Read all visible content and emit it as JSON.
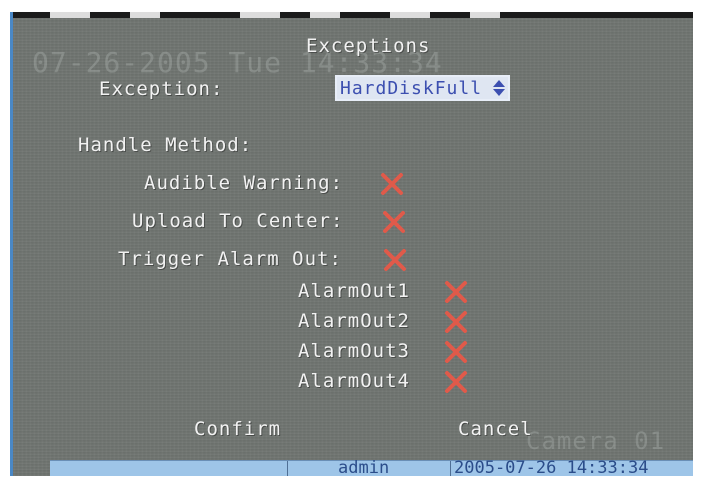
{
  "overlay": {
    "osd_datetime": "07-26-2005 Tue 14:33:34",
    "camera_label": "Camera 01"
  },
  "dialog": {
    "title": "Exceptions",
    "exception_label": "Exception:",
    "exception_value": "HardDiskFull",
    "handle_method_label": "Handle Method:",
    "audible_warning_label": "Audible Warning:",
    "upload_to_center_label": "Upload To Center:",
    "trigger_alarm_out_label": "Trigger Alarm Out:",
    "alarm_outs": [
      "AlarmOut1",
      "AlarmOut2",
      "AlarmOut3",
      "AlarmOut4"
    ],
    "confirm_label": "Confirm",
    "cancel_label": "Cancel",
    "checkbox_state": "unchecked",
    "checkbox_color": "#e05a4a"
  },
  "statusbar": {
    "user": "admin",
    "datetime": "2005-07-26 14:33:34"
  },
  "colors": {
    "background": "#6f7470",
    "text": "#f2f2f2",
    "status_bg": "#9ec5e8",
    "select_bg": "#dfe6f2",
    "select_text": "#3c4fb0"
  }
}
